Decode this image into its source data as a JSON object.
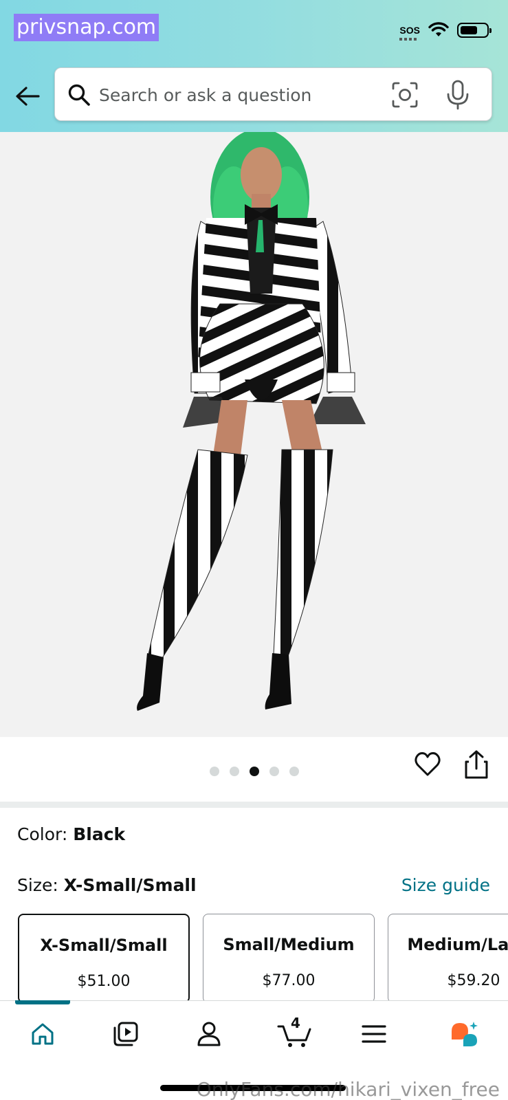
{
  "watermark_top": "privsnap.com",
  "watermark_bottom": "OnlyFans.com/hikari_vixen_free",
  "status_bar": {
    "sos": "SOS"
  },
  "search": {
    "placeholder": "Search or ask a question"
  },
  "icons": {
    "back": "arrow-left-icon",
    "search": "search-icon",
    "camera": "camera-scan-icon",
    "mic": "microphone-icon",
    "heart": "heart-icon",
    "share": "share-icon"
  },
  "product_image": {
    "alt": "Striped costume with green wig",
    "active_slide": 3,
    "slide_count": 5
  },
  "variations": {
    "color_label": "Color: ",
    "color_value": "Black",
    "size_label": "Size: ",
    "size_value": "X-Small/Small",
    "size_guide": "Size guide",
    "options": [
      {
        "name": "X-Small/Small",
        "price": "$51.00",
        "selected": true
      },
      {
        "name": "Small/Medium",
        "price": "$77.00",
        "selected": false
      },
      {
        "name": "Medium/Large",
        "price": "$59.20",
        "selected": false
      }
    ]
  },
  "bottom_nav": {
    "items": [
      "home",
      "video",
      "account",
      "cart",
      "menu",
      "rufus"
    ],
    "cart_count": "4"
  },
  "colors": {
    "accent": "#007185",
    "header_start": "#82d8e3",
    "header_end": "#a6e4d7",
    "rufus_orange": "#ff6a2b",
    "rufus_teal": "#1aa3b8"
  }
}
